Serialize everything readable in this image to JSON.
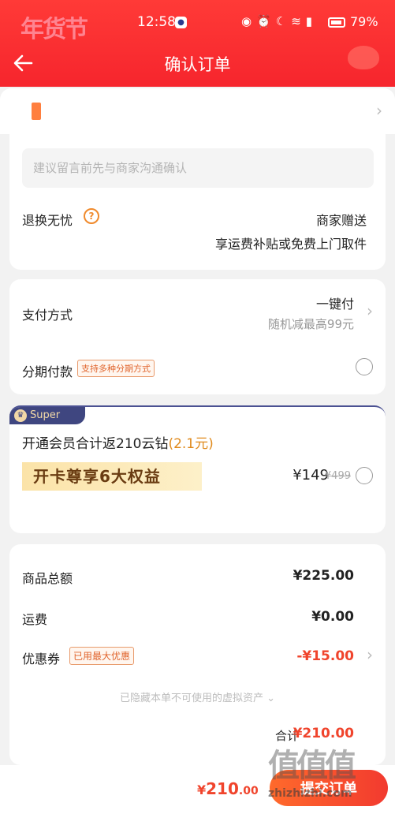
{
  "status_bar": {
    "time": "12:58",
    "battery": "79%"
  },
  "header": {
    "festival_logo": "年货节",
    "title": "确认订单"
  },
  "order_note": {
    "placeholder": "建议留言前先与商家沟通确认"
  },
  "return_service": {
    "label": "退换无忧",
    "value": "商家赠送",
    "sub": "享运费补贴或免费上门取件"
  },
  "payment": {
    "label": "支付方式",
    "method": "一键付",
    "promo": "随机减最高99元",
    "installment_label": "分期付款",
    "installment_badge": "支持多种分期方式"
  },
  "membership": {
    "tag": "Super",
    "title_prefix": "开通会员合计返210云钻",
    "title_highlight": "(2.1元)",
    "banner": "开卡尊享6大权益",
    "price": "¥149",
    "original_price": "¥499"
  },
  "summary": {
    "subtotal_label": "商品总额",
    "subtotal_value": "¥225.00",
    "shipping_label": "运费",
    "shipping_value": "¥0.00",
    "coupon_label": "优惠券",
    "coupon_badge": "已用最大优惠",
    "coupon_value": "-¥15.00",
    "hidden_note": "已隐藏本单不可使用的虚拟资产",
    "total_label": "合计",
    "total_value": "¥210.00"
  },
  "bottom_bar": {
    "currency": "¥",
    "amount": "210",
    "decimal": ".00",
    "submit_label": "提交订单"
  },
  "watermark": {
    "text": "值值值",
    "sub": "zhizhizhi.com"
  },
  "colors": {
    "header": "#f6252d",
    "accent": "#f0442c",
    "badge": "#e0642c"
  }
}
